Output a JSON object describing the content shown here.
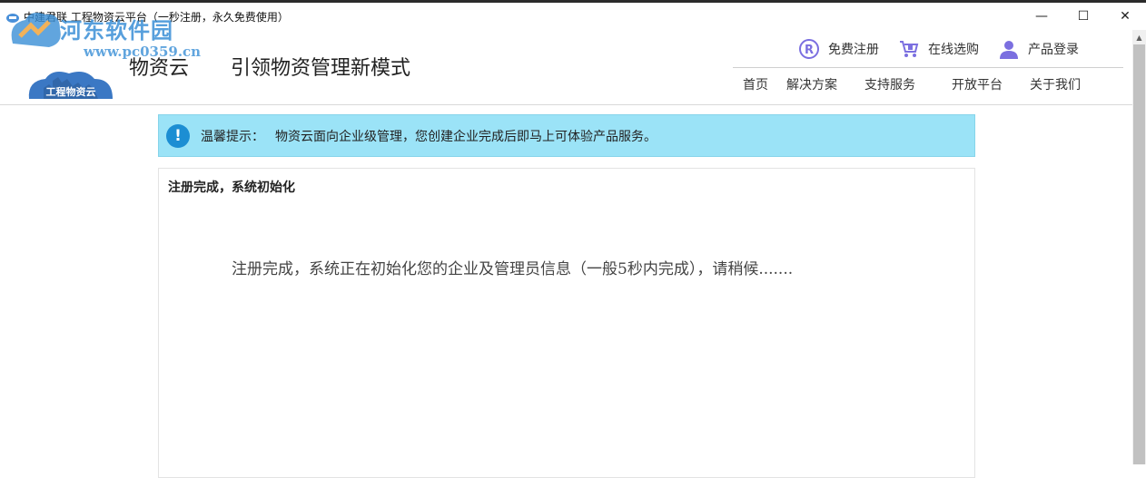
{
  "window": {
    "title": "中建君联 工程物资云平台（一秒注册，永久免费使用）",
    "minimize_symbol": "—",
    "maximize_symbol": "☐",
    "close_symbol": "✕"
  },
  "watermark": {
    "site_name": "河东软件园",
    "site_url": "www.pc0359.cn"
  },
  "header": {
    "logo_text": "工程物资云",
    "brand": "物资云",
    "slogan": "引领物资管理新模式",
    "actions": [
      {
        "label": "免费注册",
        "icon": "registered-icon"
      },
      {
        "label": "在线选购",
        "icon": "cart-icon"
      },
      {
        "label": "产品登录",
        "icon": "user-icon"
      }
    ],
    "nav": [
      {
        "label": "首页"
      },
      {
        "label": "解决方案"
      },
      {
        "label": "支持服务"
      },
      {
        "label": "开放平台"
      },
      {
        "label": "关于我们"
      }
    ]
  },
  "notice": {
    "icon_glyph": "!",
    "label": "温馨提示：",
    "text": "物资云面向企业级管理，您创建企业完成后即马上可体验产品服务。"
  },
  "panel": {
    "title": "注册完成，系统初始化",
    "message": "注册完成，系统正在初始化您的企业及管理员信息（一般5秒内完成），请稍候.......",
    "scroll_up_symbol": "▲"
  },
  "colors": {
    "notice_bg": "#9be3f7",
    "info_icon": "#1c8ed3",
    "action_icon": "#7b6fe0",
    "watermark": "#3a8fd6"
  }
}
